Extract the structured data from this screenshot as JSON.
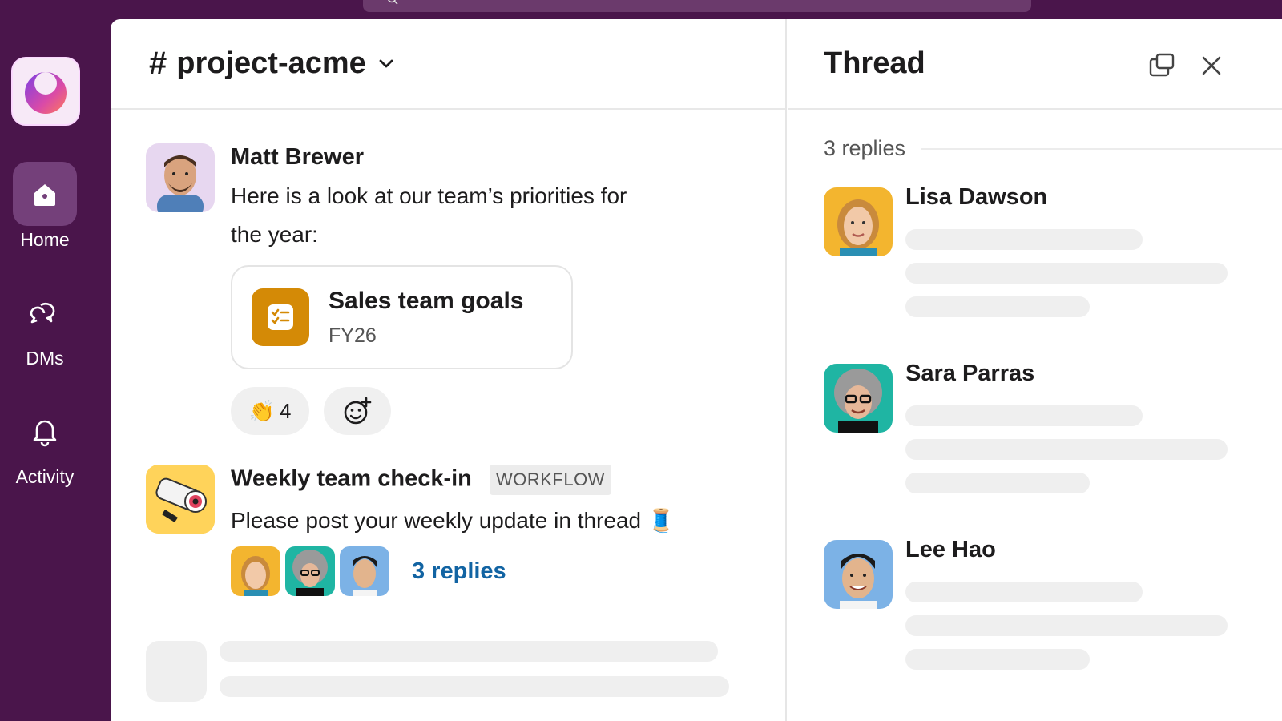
{
  "colors": {
    "sidebar": "#4a154b",
    "link": "#1264a3",
    "file_icon": "#d48a06"
  },
  "rail": {
    "items": [
      {
        "label": "Home",
        "icon": "home-icon",
        "active": true
      },
      {
        "label": "DMs",
        "icon": "dms-icon",
        "active": false
      },
      {
        "label": "Activity",
        "icon": "bell-icon",
        "active": false
      }
    ]
  },
  "channel": {
    "hash": "#",
    "name": "project-acme"
  },
  "messages": [
    {
      "sender": "Matt Brewer",
      "text": "Here is a look at our team’s priorities for the year:",
      "file": {
        "title": "Sales team goals",
        "subtitle": "FY26"
      },
      "reactions": [
        {
          "emoji": "👏",
          "count": "4"
        }
      ]
    },
    {
      "sender": "Weekly team check-in",
      "badge": "WORKFLOW",
      "text": "Please post your weekly update in thread 🧵",
      "replies_label": "3 replies"
    }
  ],
  "thread": {
    "title": "Thread",
    "replies_count": "3 replies",
    "replies": [
      {
        "name": "Lisa Dawson"
      },
      {
        "name": "Sara Parras"
      },
      {
        "name": "Lee Hao"
      }
    ]
  }
}
